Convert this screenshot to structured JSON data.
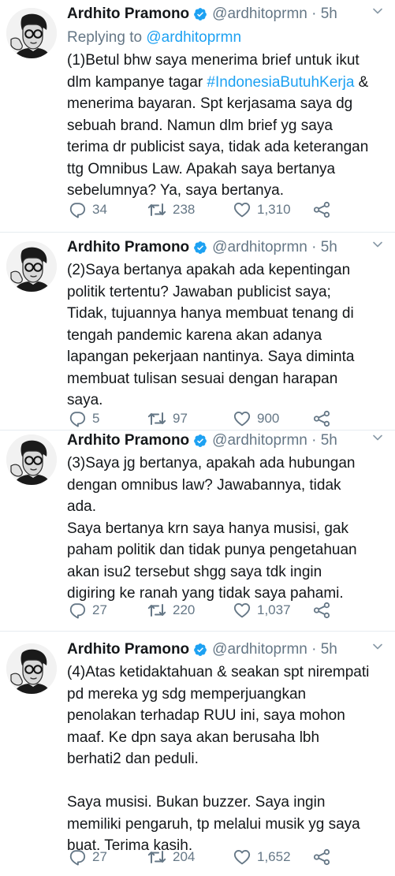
{
  "colors": {
    "text": "#14171a",
    "secondary": "#657786",
    "link": "#1da1f2",
    "verified": "#1da1f2"
  },
  "tweets": [
    {
      "name": "Ardhito Pramono",
      "handle": "@ardhitoprmn · 5h",
      "reply_prefix": "Replying to",
      "reply_handle": "@ardhitoprmn",
      "text_before": "(1)Betul bhw saya menerima brief untuk ikut\ndlm kampanye tagar ",
      "hashtag": "#IndonesiaButuhKerja",
      "text_after": " &\nmenerima bayaran. Spt kerjasama saya dg\nsebuah brand. Namun dlm brief yg saya\nterima dr publicist saya, tidak ada keterangan\nttg Omnibus Law. Apakah saya bertanya\nsebelumnya? Ya, saya bertanya.",
      "replies": "34",
      "retweets": "238",
      "likes": "1,310"
    },
    {
      "name": "Ardhito Pramono",
      "handle": "@ardhitoprmn · 5h",
      "text": "(2)Saya bertanya apakah ada kepentingan\npolitik tertentu? Jawaban publicist saya;\nTidak, tujuannya hanya membuat tenang di\ntengah pandemic karena akan adanya\nlapangan pekerjaan nantinya. Saya diminta\nmembuat tulisan sesuai dengan harapan\nsaya.",
      "replies": "5",
      "retweets": "97",
      "likes": "900"
    },
    {
      "name": "Ardhito Pramono",
      "handle": "@ardhitoprmn · 5h",
      "text": "(3)Saya jg bertanya, apakah ada hubungan\ndengan omnibus law? Jawabannya, tidak\nada.\nSaya bertanya krn saya hanya musisi, gak\npaham politik dan tidak punya pengetahuan\nakan isu2 tersebut shgg saya tdk ingin\ndigiring ke ranah yang tidak saya pahami.",
      "replies": "27",
      "retweets": "220",
      "likes": "1,037"
    },
    {
      "name": "Ardhito Pramono",
      "handle": "@ardhitoprmn · 5h",
      "text": "(4)Atas ketidaktahuan & seakan spt nirempati\npd mereka yg sdg memperjuangkan\npenolakan terhadap RUU ini, saya mohon\nmaaf. Ke dpn saya akan berusaha lbh\nberhati2 dan peduli.\n\nSaya musisi. Bukan buzzer. Saya ingin\nmemiliki pengaruh, tp melalui musik yg saya\nbuat. Terima kasih.",
      "replies": "27",
      "retweets": "204",
      "likes": "1,652"
    }
  ]
}
